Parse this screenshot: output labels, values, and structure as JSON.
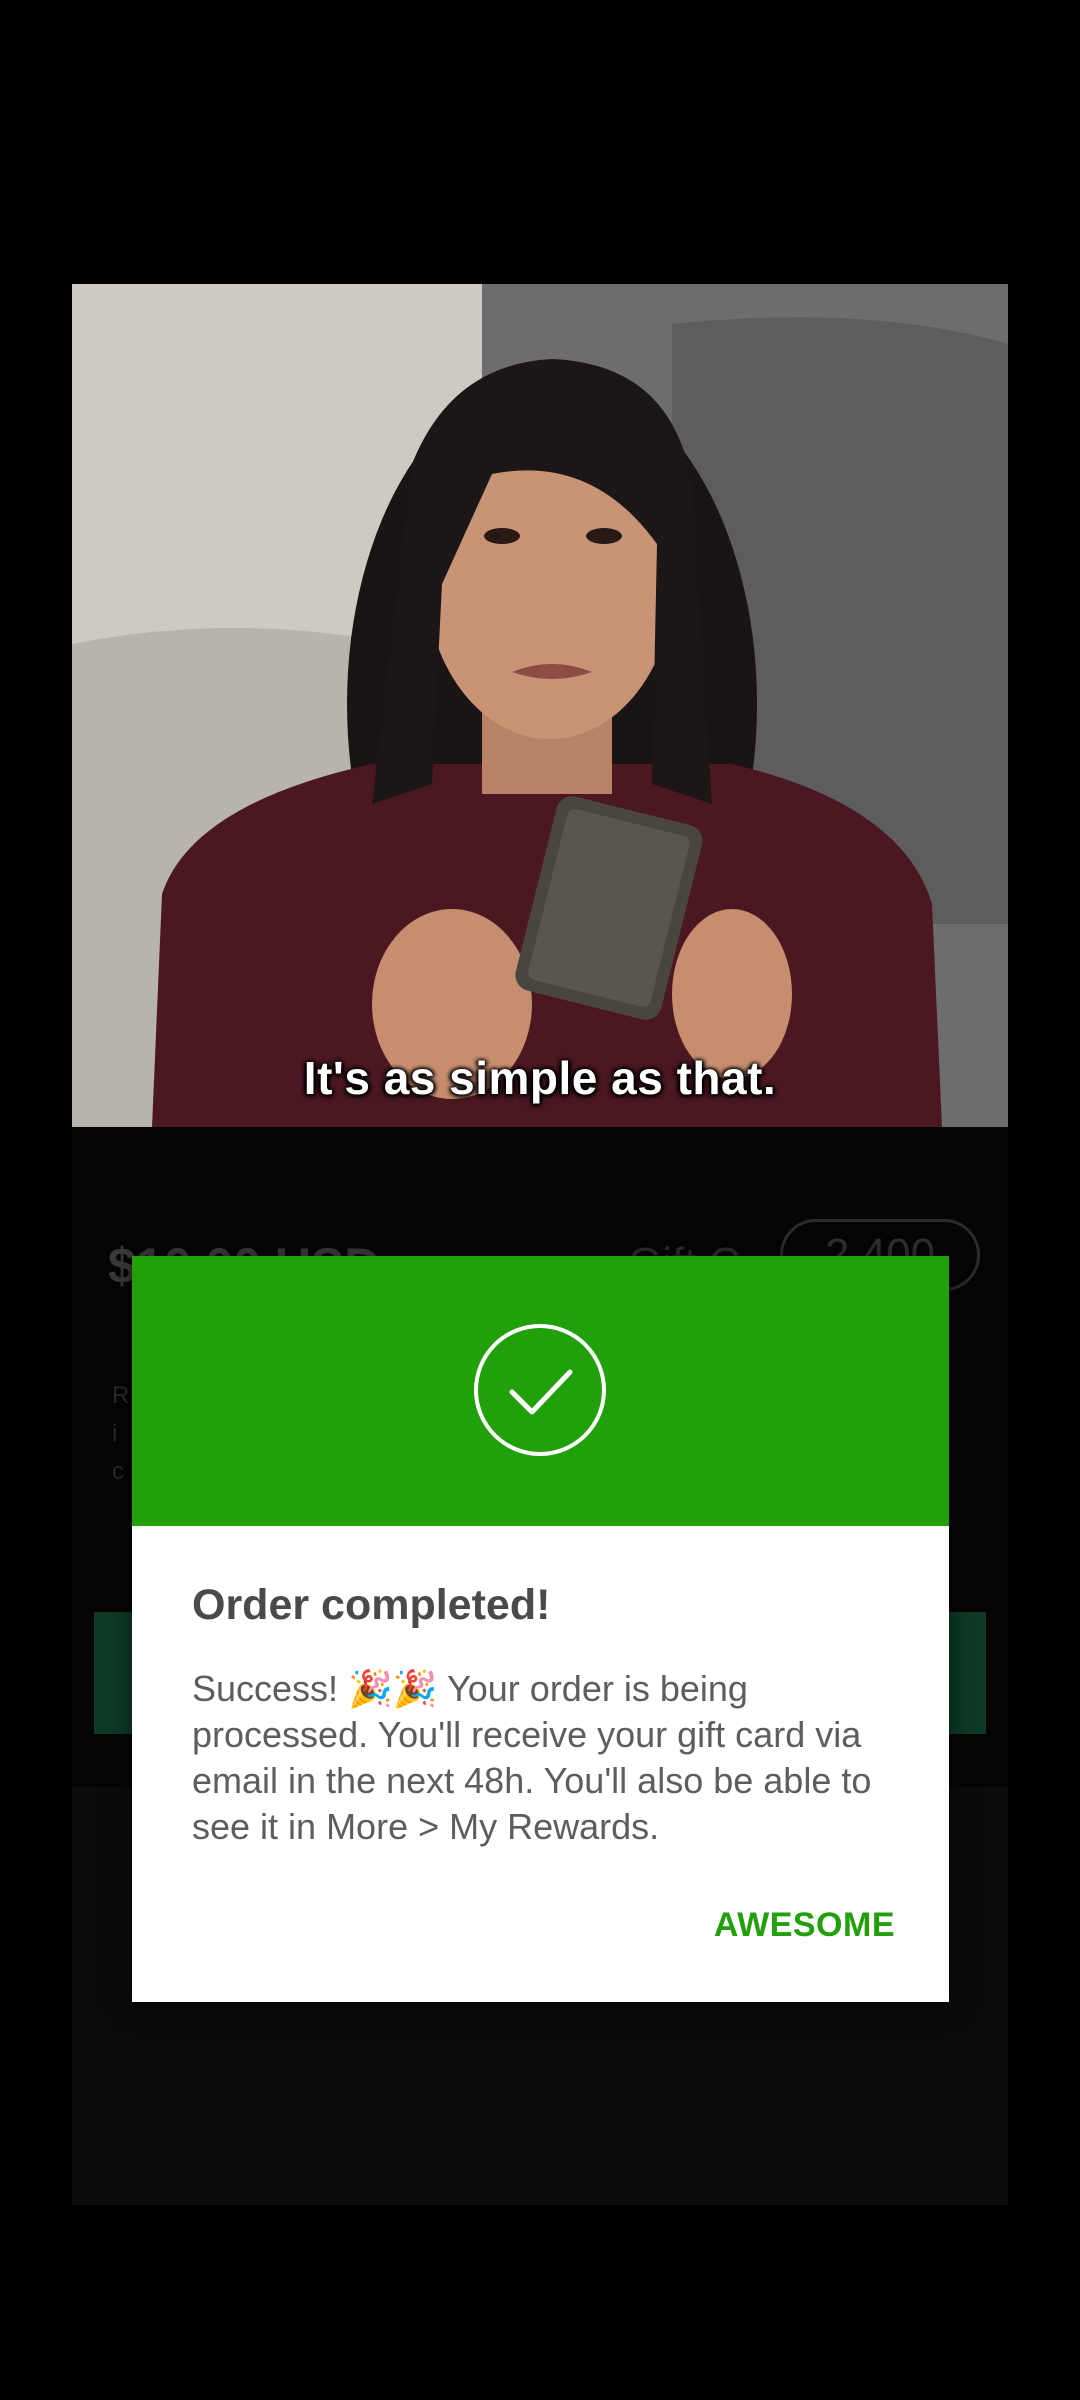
{
  "video": {
    "subtitle": "It's as simple as that."
  },
  "background_app": {
    "price": "$10.00 USD",
    "gift_label": "Gift C",
    "points": "2,400",
    "description_fragment": "R\ni\nc"
  },
  "dialog": {
    "icon": "check-circle-icon",
    "title": "Order completed!",
    "message": "Success! 🎉🎉 Your order is being processed. You'll receive your gift card via email in the next 48h. You'll also be able to see it in More > My Rewards.",
    "action_label": "AWESOME"
  },
  "colors": {
    "accent_green": "#21a00c",
    "scrim": "#000000",
    "dialog_background": "#ffffff"
  }
}
